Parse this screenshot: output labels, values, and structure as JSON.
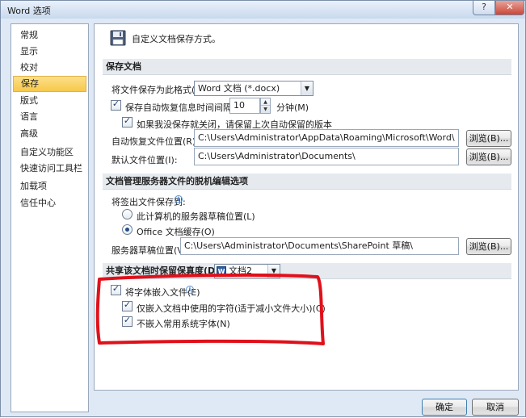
{
  "window": {
    "title": "Word 选项",
    "help_label": "?",
    "close_label": "✕"
  },
  "sidebar": {
    "items": [
      {
        "label": "常规"
      },
      {
        "label": "显示"
      },
      {
        "label": "校对"
      },
      {
        "label": "保存",
        "selected": true
      },
      {
        "label": "版式"
      },
      {
        "label": "语言"
      },
      {
        "label": "高级"
      },
      {
        "label": "自定义功能区"
      },
      {
        "label": "快速访问工具栏"
      },
      {
        "label": "加载项"
      },
      {
        "label": "信任中心"
      }
    ]
  },
  "header": {
    "icon": "floppy-disk-icon",
    "text": "自定义文档保存方式。"
  },
  "save_documents": {
    "section_title": "保存文档",
    "format_label": "将文件保存为此格式(F):",
    "format_value": "Word 文档 (*.docx)",
    "autorecover_label": "保存自动恢复信息时间间隔(A)",
    "autorecover_checked": true,
    "autorecover_minutes": "10",
    "minutes_label": "分钟(M)",
    "keep_last_label": "如果我没保存就关闭，请保留上次自动保留的版本",
    "keep_last_checked": true,
    "autorecover_location_label": "自动恢复文件位置(R):",
    "autorecover_location_value": "C:\\Users\\Administrator\\AppData\\Roaming\\Microsoft\\Word\\",
    "default_location_label": "默认文件位置(I):",
    "default_location_value": "C:\\Users\\Administrator\\Documents\\",
    "browse_label": "浏览(B)..."
  },
  "offline_editing": {
    "section_title": "文档管理服务器文件的脱机编辑选项",
    "save_checked_out_label": "将签出文件保存到:",
    "option_server_label": "此计算机的服务器草稿位置(L)",
    "option_server_selected": false,
    "option_cache_label": "Office 文档缓存(O)",
    "option_cache_selected": true,
    "drafts_location_label": "服务器草稿位置(V):",
    "drafts_location_value": "C:\\Users\\Administrator\\Documents\\SharePoint 草稿\\",
    "browse_label": "浏览(B)..."
  },
  "fidelity": {
    "section_title": "共享该文档时保留保真度(D):",
    "document_value": "文档2",
    "embed_fonts_label": "将字体嵌入文件(E)",
    "embed_fonts_checked": true,
    "embed_used_chars_label": "仅嵌入文档中使用的字符(适于减小文件大小)(C)",
    "embed_used_chars_checked": true,
    "no_common_fonts_label": "不嵌入常用系统字体(N)",
    "no_common_fonts_checked": true
  },
  "footer": {
    "ok_label": "确定",
    "cancel_label": "取消"
  },
  "colors": {
    "annotation_red": "#e0101a",
    "selected_bg": "#f7c84a"
  }
}
